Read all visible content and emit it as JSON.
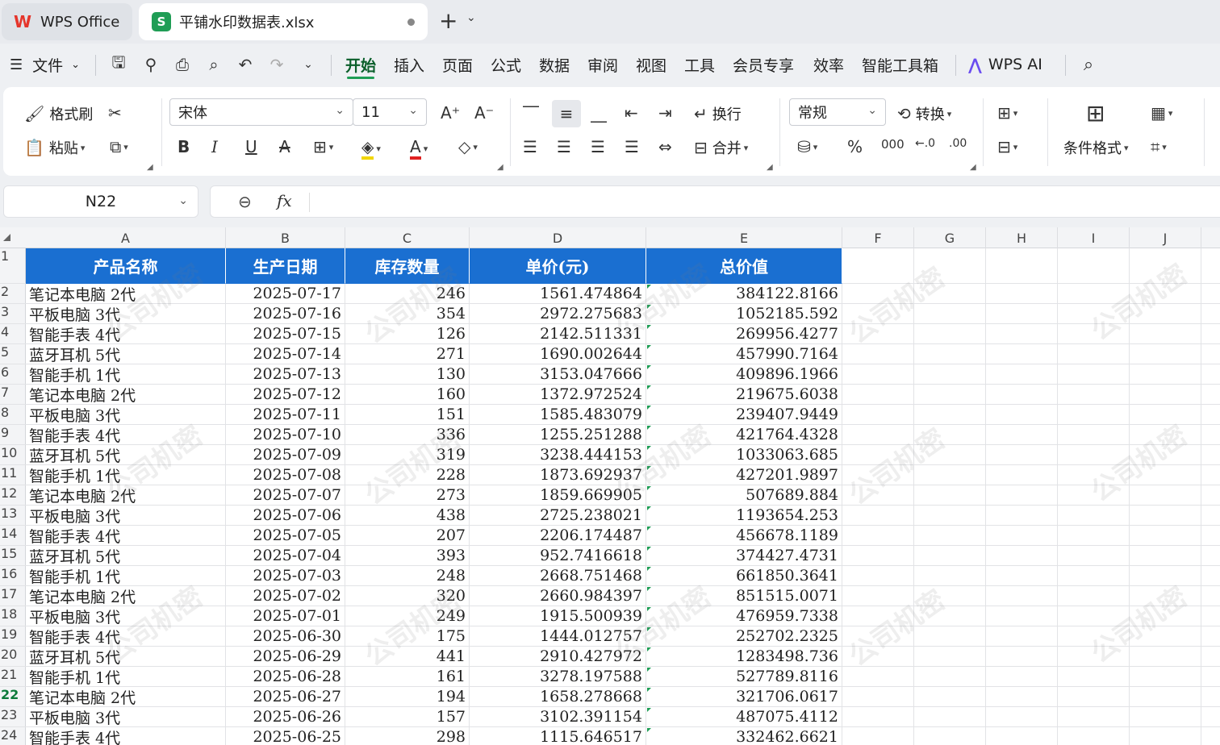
{
  "tabs": {
    "home_label": "WPS Office",
    "file_label": "平铺水印数据表.xlsx",
    "add_symbol": "+"
  },
  "menu": {
    "file": "文件",
    "items": [
      "开始",
      "插入",
      "页面",
      "公式",
      "数据",
      "审阅",
      "视图",
      "工具",
      "会员专享",
      "效率",
      "智能工具箱"
    ],
    "active": "开始",
    "ai_label": "WPS AI"
  },
  "ribbon": {
    "format_painter": "格式刷",
    "paste": "粘贴",
    "font_name": "宋体",
    "font_size": "11",
    "wrap": "换行",
    "merge": "合并",
    "number_format": "常规",
    "convert": "转换",
    "conditional_format": "条件格式"
  },
  "formula_bar": {
    "cell_ref": "N22",
    "fx": "fx",
    "content": ""
  },
  "columns": [
    "A",
    "B",
    "C",
    "D",
    "E",
    "F",
    "G",
    "H",
    "I",
    "J"
  ],
  "row_numbers": [
    "1",
    "2",
    "3",
    "4",
    "5",
    "6",
    "7",
    "8",
    "9",
    "10",
    "11",
    "12",
    "13",
    "14",
    "15",
    "16",
    "17",
    "18",
    "19",
    "20",
    "21",
    "22",
    "23",
    "24"
  ],
  "selected_row": "22",
  "watermark_text": "公司机密",
  "table": {
    "headers": [
      "产品名称",
      "生产日期",
      "库存数量",
      "单价(元)",
      "总价值"
    ],
    "rows": [
      [
        "笔记本电脑 2代",
        "2025-07-17",
        "246",
        "1561.474864",
        "384122.8166"
      ],
      [
        "平板电脑 3代",
        "2025-07-16",
        "354",
        "2972.275683",
        "1052185.592"
      ],
      [
        "智能手表 4代",
        "2025-07-15",
        "126",
        "2142.511331",
        "269956.4277"
      ],
      [
        "蓝牙耳机 5代",
        "2025-07-14",
        "271",
        "1690.002644",
        "457990.7164"
      ],
      [
        "智能手机 1代",
        "2025-07-13",
        "130",
        "3153.047666",
        "409896.1966"
      ],
      [
        "笔记本电脑 2代",
        "2025-07-12",
        "160",
        "1372.972524",
        "219675.6038"
      ],
      [
        "平板电脑 3代",
        "2025-07-11",
        "151",
        "1585.483079",
        "239407.9449"
      ],
      [
        "智能手表 4代",
        "2025-07-10",
        "336",
        "1255.251288",
        "421764.4328"
      ],
      [
        "蓝牙耳机 5代",
        "2025-07-09",
        "319",
        "3238.444153",
        "1033063.685"
      ],
      [
        "智能手机 1代",
        "2025-07-08",
        "228",
        "1873.692937",
        "427201.9897"
      ],
      [
        "笔记本电脑 2代",
        "2025-07-07",
        "273",
        "1859.669905",
        "507689.884"
      ],
      [
        "平板电脑 3代",
        "2025-07-06",
        "438",
        "2725.238021",
        "1193654.253"
      ],
      [
        "智能手表 4代",
        "2025-07-05",
        "207",
        "2206.174487",
        "456678.1189"
      ],
      [
        "蓝牙耳机 5代",
        "2025-07-04",
        "393",
        "952.7416618",
        "374427.4731"
      ],
      [
        "智能手机 1代",
        "2025-07-03",
        "248",
        "2668.751468",
        "661850.3641"
      ],
      [
        "笔记本电脑 2代",
        "2025-07-02",
        "320",
        "2660.984397",
        "851515.0071"
      ],
      [
        "平板电脑 3代",
        "2025-07-01",
        "249",
        "1915.500939",
        "476959.7338"
      ],
      [
        "智能手表 4代",
        "2025-06-30",
        "175",
        "1444.012757",
        "252702.2325"
      ],
      [
        "蓝牙耳机 5代",
        "2025-06-29",
        "441",
        "2910.427972",
        "1283498.736"
      ],
      [
        "智能手机 1代",
        "2025-06-28",
        "161",
        "3278.197588",
        "527789.8116"
      ],
      [
        "笔记本电脑 2代",
        "2025-06-27",
        "194",
        "1658.278668",
        "321706.0617"
      ],
      [
        "平板电脑 3代",
        "2025-06-26",
        "157",
        "3102.391154",
        "487075.4112"
      ],
      [
        "智能手表 4代",
        "2025-06-25",
        "298",
        "1115.646517",
        "332462.6621"
      ]
    ]
  },
  "colors": {
    "header_fill": "#1a6fd1",
    "accent_green": "#1f9d55",
    "brand_red": "#e5352b"
  }
}
